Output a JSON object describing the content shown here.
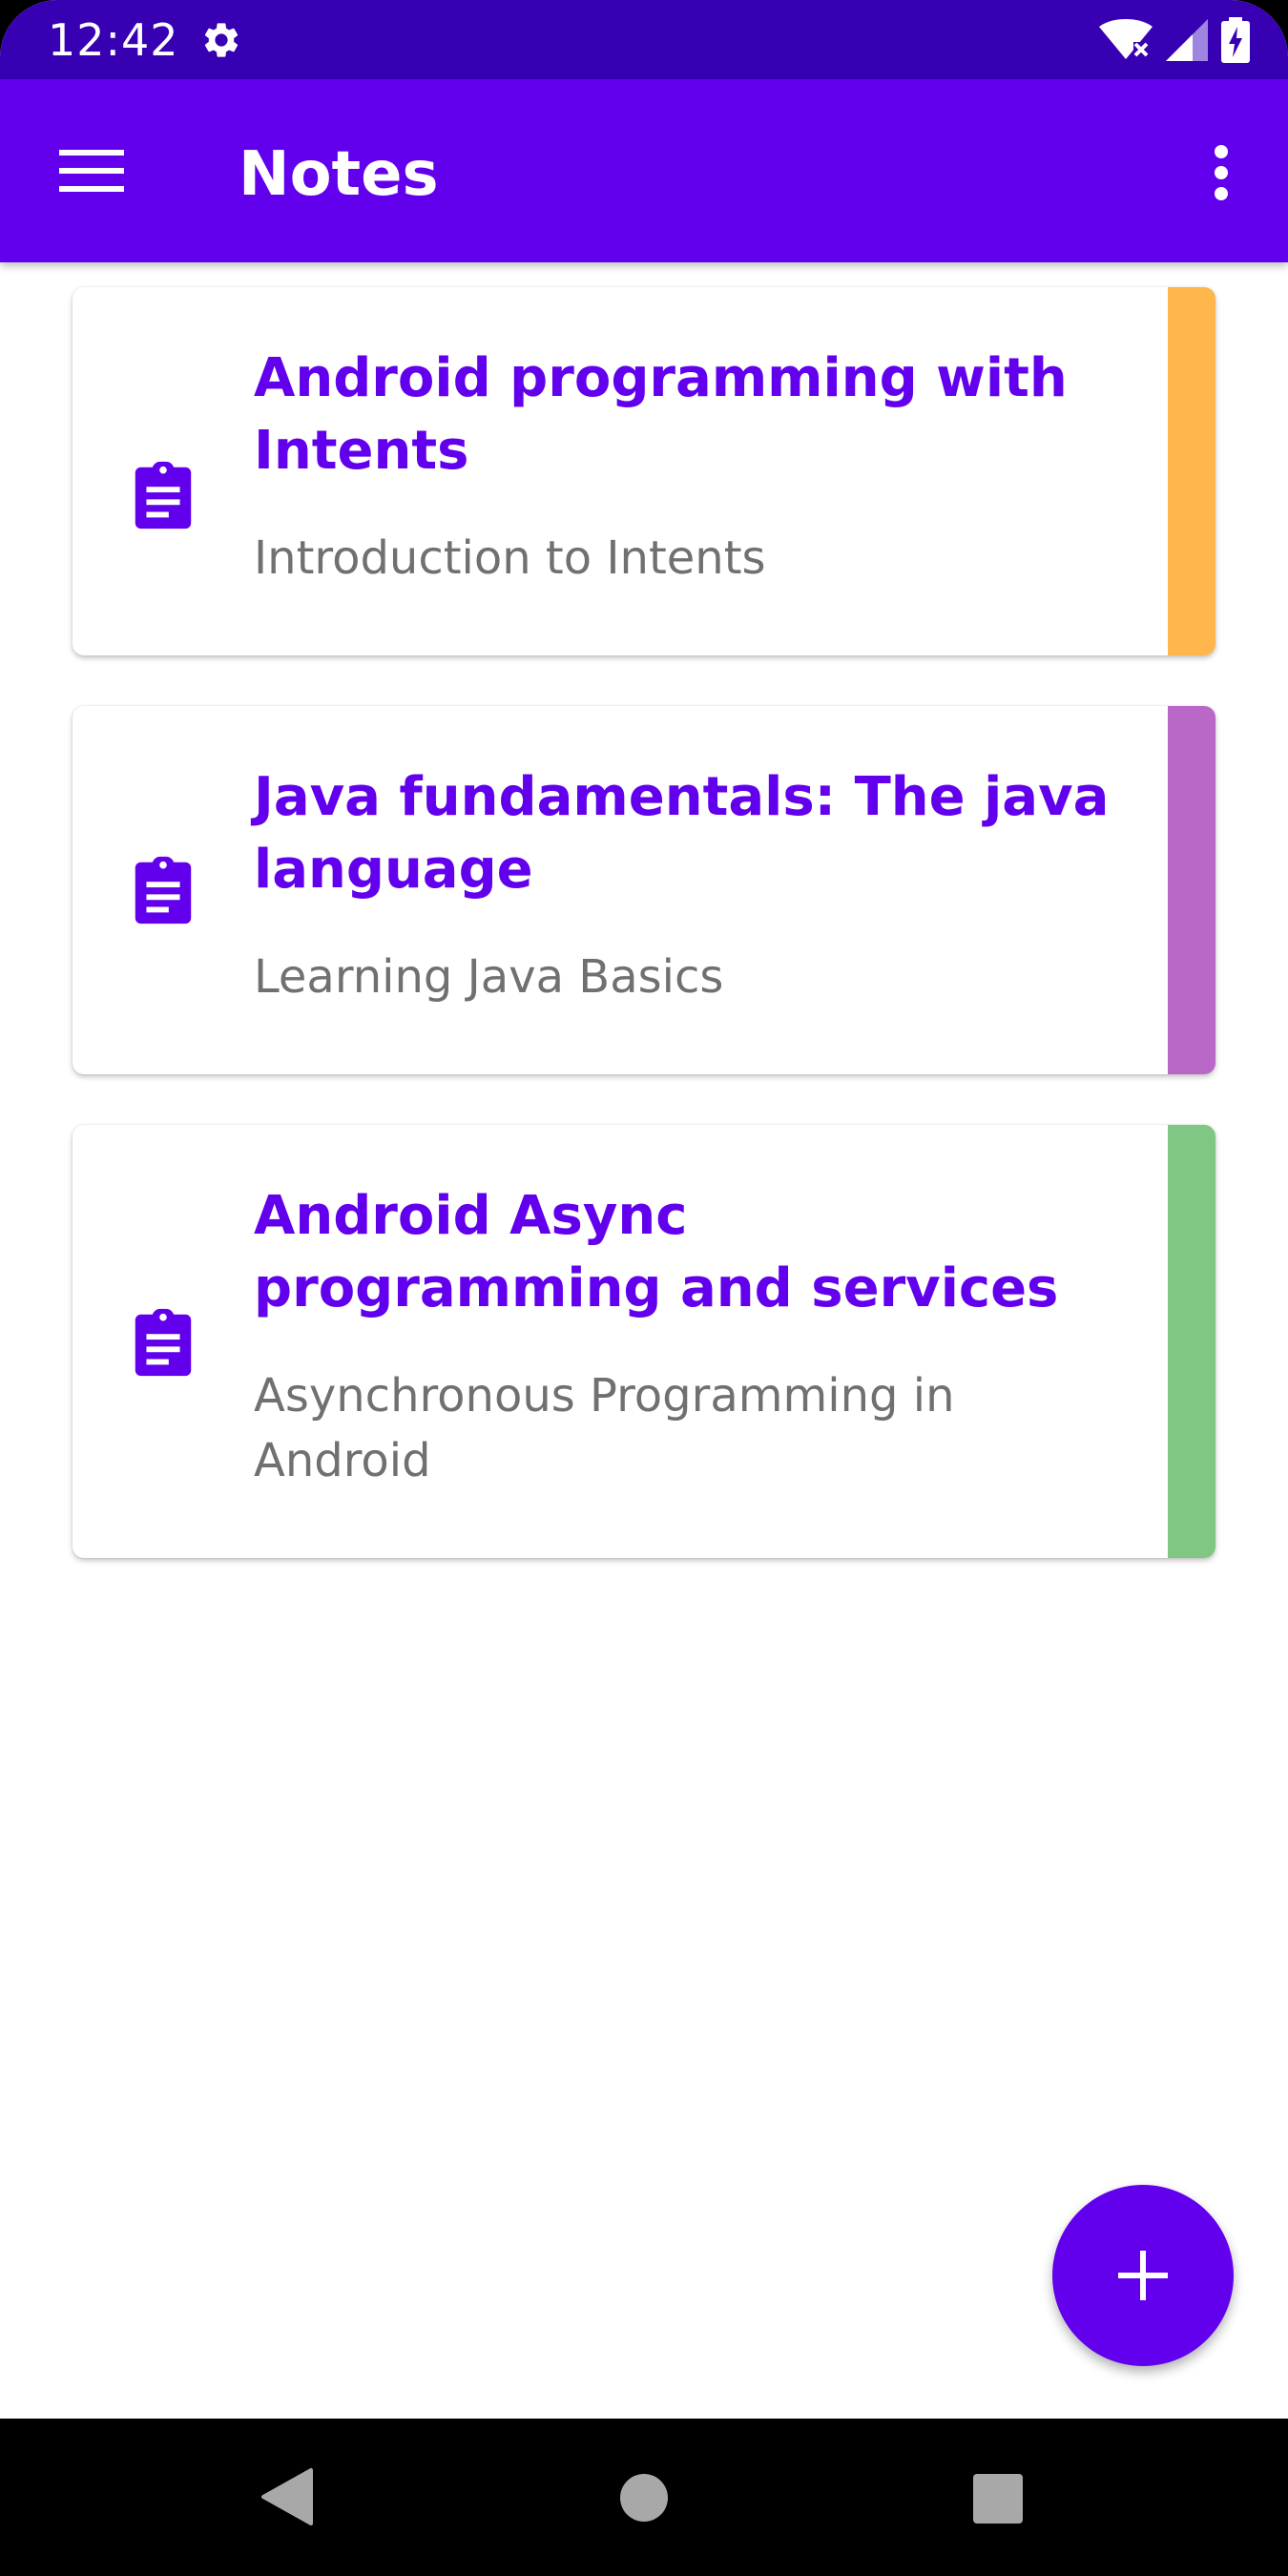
{
  "status_bar": {
    "time": "12:42",
    "icons": [
      "settings-gear-icon",
      "wifi-icon",
      "cell-signal-icon",
      "battery-charging-icon"
    ]
  },
  "app_bar": {
    "title": "Notes",
    "menu_icon": "hamburger-menu-icon",
    "overflow_icon": "more-vert-icon"
  },
  "notes": [
    {
      "title": "Android programming with Intents",
      "subtitle": "Introduction to Intents",
      "icon": "assignment-clipboard-icon",
      "color": "#FFB74D"
    },
    {
      "title": "Java fundamentals: The java language",
      "subtitle": "Learning Java Basics",
      "icon": "assignment-clipboard-icon",
      "color": "#BA68C8"
    },
    {
      "title": "Android Async programming and services",
      "subtitle": "Asynchronous Programming in Android",
      "icon": "assignment-clipboard-icon",
      "color": "#81C784"
    }
  ],
  "fab": {
    "icon": "plus-icon"
  },
  "nav_bar": {
    "icons": [
      "back-icon",
      "home-icon",
      "recents-icon"
    ]
  },
  "colors": {
    "primary": "#6200EE",
    "primary_dark": "#3700B3",
    "subtitle_text": "#707070"
  }
}
